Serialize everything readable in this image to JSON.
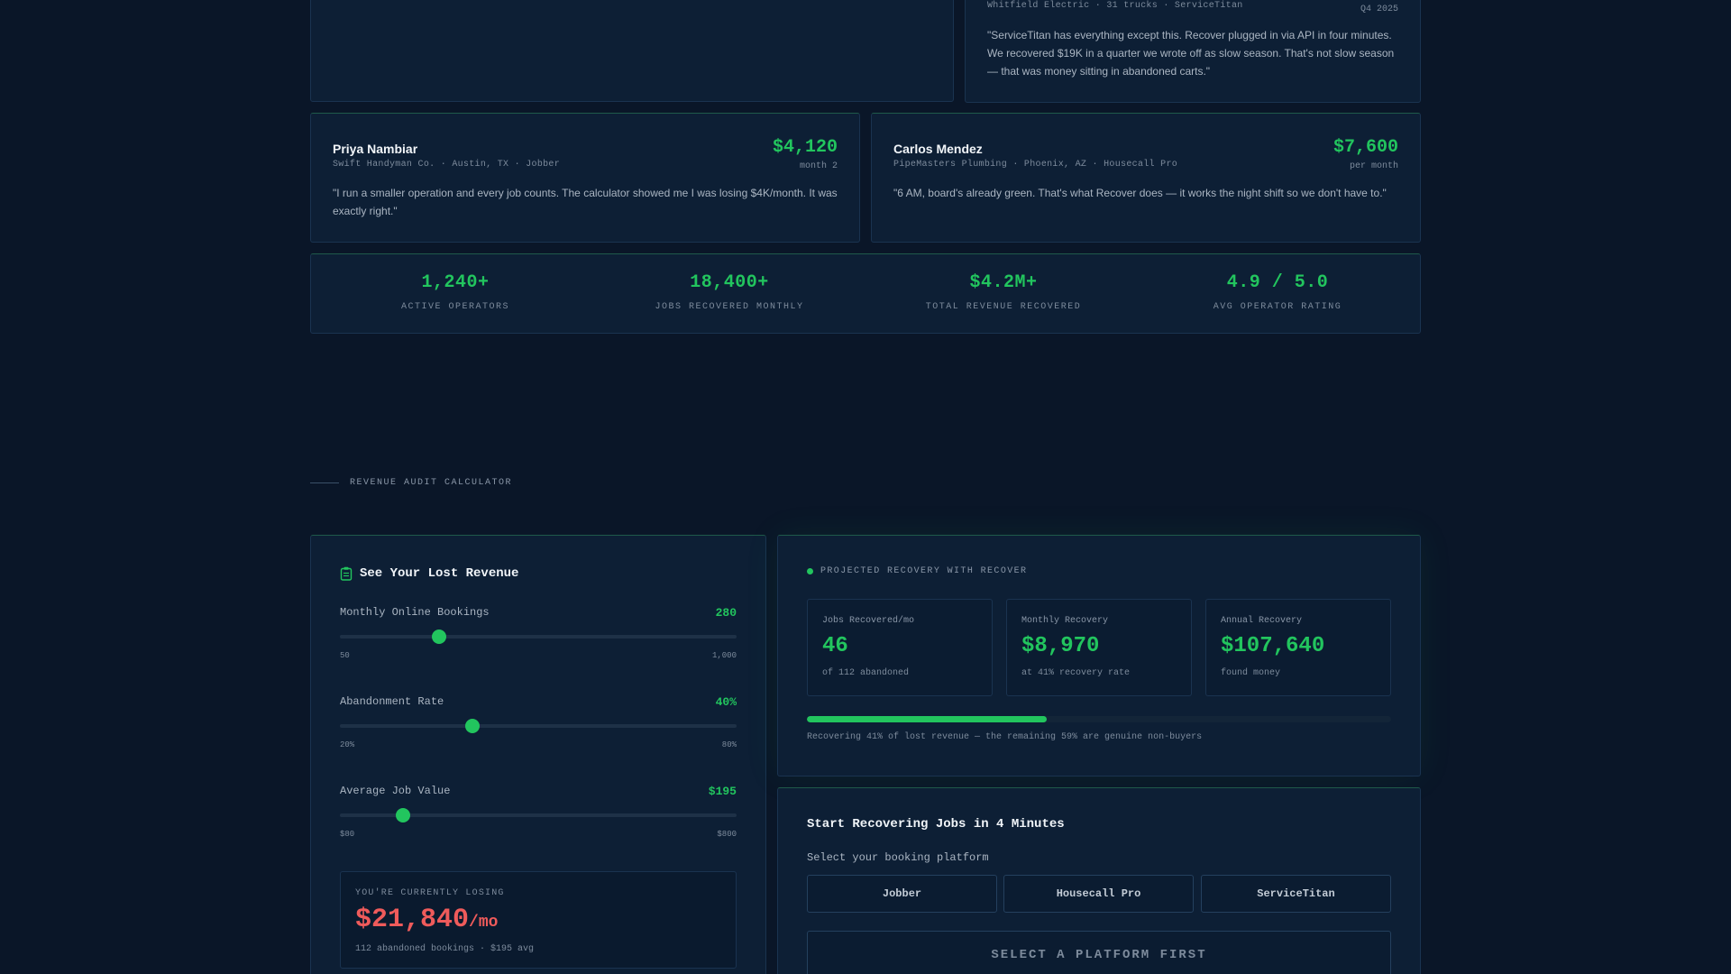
{
  "testimonials": {
    "top_right": {
      "meta": "Whitfield Electric · 31 trucks · ServiceTitan",
      "period": "Q4 2025",
      "quote": "\"ServiceTitan has everything except this. Recover plugged in via API in four minutes. We recovered $19K in a quarter we wrote off as slow season. That's not slow season — that was money sitting in abandoned carts.\""
    },
    "priya": {
      "name": "Priya Nambiar",
      "meta": "Swift Handyman Co. · Austin, TX · Jobber",
      "amount": "$4,120",
      "period": "month 2",
      "quote": "\"I run a smaller operation and every job counts. The calculator showed me I was losing $4K/month. It was exactly right.\""
    },
    "carlos": {
      "name": "Carlos Mendez",
      "meta": "PipeMasters Plumbing · Phoenix, AZ · Housecall Pro",
      "amount": "$7,600",
      "period": "per month",
      "quote": "\"6 AM, board's already green. That's what Recover does — it works the night shift so we don't have to.\""
    }
  },
  "stats": [
    {
      "value": "1,240+",
      "label": "ACTIVE OPERATORS"
    },
    {
      "value": "18,400+",
      "label": "JOBS RECOVERED MONTHLY"
    },
    {
      "value": "$4.2M+",
      "label": "TOTAL REVENUE RECOVERED"
    },
    {
      "value": "4.9 / 5.0",
      "label": "AVG OPERATOR RATING"
    }
  ],
  "section_label": "REVENUE AUDIT CALCULATOR",
  "calculator": {
    "title": "See Your Lost Revenue",
    "icon": "clipboard-icon",
    "sliders": [
      {
        "label": "Monthly Online Bookings",
        "value": "280",
        "min": "50",
        "max": "1,000",
        "fraction": 0.25
      },
      {
        "label": "Abandonment Rate",
        "value": "40%",
        "min": "20%",
        "max": "80%",
        "fraction": 0.3333
      },
      {
        "label": "Average Job Value",
        "value": "$195",
        "min": "$80",
        "max": "$800",
        "fraction": 0.16
      }
    ],
    "losing": {
      "label": "YOU'RE CURRENTLY LOSING",
      "amount": "$21,840",
      "unit": "/mo",
      "sub": "112 abandoned bookings · $195 avg"
    }
  },
  "recovery": {
    "label": "PROJECTED RECOVERY WITH RECOVER",
    "metrics": [
      {
        "label": "Jobs Recovered/mo",
        "value": "46",
        "sub": "of 112 abandoned"
      },
      {
        "label": "Monthly Recovery",
        "value": "$8,970",
        "sub": "at 41% recovery rate"
      },
      {
        "label": "Annual Recovery",
        "value": "$107,640",
        "sub": "found money"
      }
    ],
    "progress_percent": 41,
    "note": "Recovering 41% of lost revenue — the remaining 59% are genuine non-buyers"
  },
  "start": {
    "title": "Start Recovering Jobs in 4 Minutes",
    "subtitle": "Select your booking platform",
    "platforms": [
      "Jobber",
      "Housecall Pro",
      "ServiceTitan"
    ],
    "cta": "SELECT A PLATFORM FIRST"
  },
  "colors": {
    "background": "#0a1628",
    "accent": "#22c55e",
    "loss": "#ef5b5b"
  }
}
